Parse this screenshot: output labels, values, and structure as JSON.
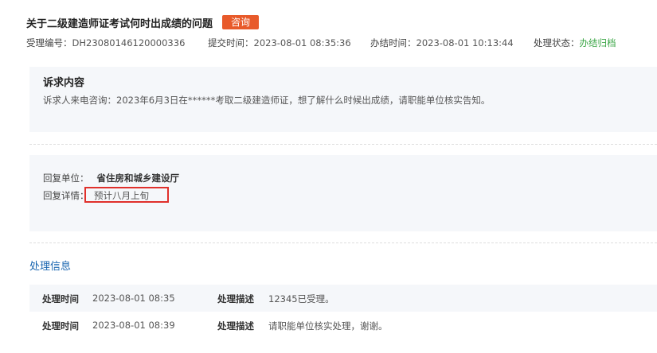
{
  "header": {
    "title": "关于二级建造师证考试何时出成绩的问题",
    "tag": "咨询"
  },
  "meta": {
    "id_label": "受理编号：",
    "id_value": "DH23080146120000336",
    "submit_label": "提交时间：",
    "submit_value": "2023-08-01 08:35:36",
    "done_label": "办结时间：",
    "done_value": "2023-08-01 10:13:44",
    "status_label": "处理状态：",
    "status_value": "办结归档"
  },
  "complaint": {
    "heading": "诉求内容",
    "text": "诉求人来电咨询：2023年6月3日在******考取二级建造师证，想了解什么时候出成绩，请职能单位核实告知。"
  },
  "reply": {
    "unit_label": "回复单位：",
    "unit_value": "省住房和城乡建设厅",
    "detail_label": "回复详情：",
    "detail_value": "预计八月上旬"
  },
  "processing": {
    "heading": "处理信息",
    "rows": [
      {
        "time_label": "处理时间",
        "time_value": "2023-08-01 08:35",
        "desc_label": "处理描述",
        "desc_value": "12345已受理。"
      },
      {
        "time_label": "处理时间",
        "time_value": "2023-08-01 08:39",
        "desc_label": "处理描述",
        "desc_value": "请职能单位核实处理，谢谢。"
      }
    ]
  },
  "colors": {
    "tag_bg": "#e85a2a",
    "status_green": "#3aa545",
    "link_blue": "#1a66b0",
    "highlight_red": "#e0302b"
  }
}
